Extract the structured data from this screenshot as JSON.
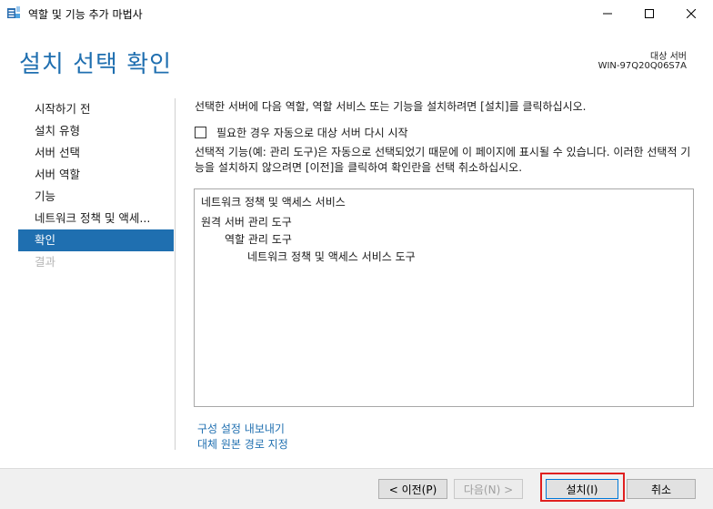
{
  "window": {
    "title": "역할 및 기능 추가 마법사",
    "icon": "server-manager-icon"
  },
  "header": {
    "title": "설치 선택 확인",
    "target_label": "대상 서버",
    "target_name": "WIN-97Q20Q06S7A"
  },
  "nav": {
    "items": [
      {
        "label": "시작하기 전",
        "state": "normal"
      },
      {
        "label": "설치 유형",
        "state": "normal"
      },
      {
        "label": "서버 선택",
        "state": "normal"
      },
      {
        "label": "서버 역할",
        "state": "normal"
      },
      {
        "label": "기능",
        "state": "normal"
      },
      {
        "label": "네트워크 정책 및 액세...",
        "state": "normal"
      },
      {
        "label": "확인",
        "state": "active"
      },
      {
        "label": "결과",
        "state": "disabled"
      }
    ]
  },
  "main": {
    "intro": "선택한 서버에 다음 역할, 역할 서비스 또는 기능을 설치하려면 [설치]를 클릭하십시오.",
    "restart_label": "필요한 경우 자동으로 대상 서버 다시 시작",
    "restart_checked": false,
    "note": "선택적 기능(예: 관리 도구)은 자동으로 선택되었기 때문에 이 페이지에 표시될 수 있습니다. 이러한 선택적 기능을 설치하지 않으려면 [이전]을 클릭하여 확인란을 선택 취소하십시오.",
    "features": [
      {
        "label": "네트워크 정책 및 액세스 서비스",
        "level": 0
      },
      {
        "label": "원격 서버 관리 도구",
        "level": 0
      },
      {
        "label": "역할 관리 도구",
        "level": 1
      },
      {
        "label": "네트워크 정책 및 액세스 서비스 도구",
        "level": 2
      }
    ],
    "links": {
      "export": "구성 설정 내보내기",
      "alt_source": "대체 원본 경로 지정"
    }
  },
  "footer": {
    "prev_label": "< 이전(P)",
    "next_label": "다음(N) >",
    "install_label": "설치(I)",
    "cancel_label": "취소"
  },
  "colors": {
    "accent": "#1f6fb0",
    "highlight_border": "#e02020"
  }
}
